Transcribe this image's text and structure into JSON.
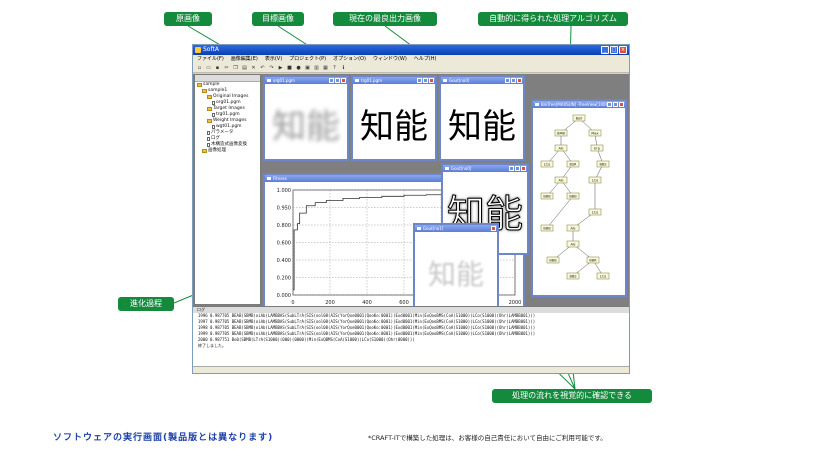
{
  "callouts": {
    "original": "原画像",
    "target": "目標画像",
    "best": "現在の最良出力画像",
    "algorithm": "自動的に得られた処理アルゴリズム",
    "evolution": "進化過程",
    "flow": "処理の流れを視覚的に確認できる"
  },
  "window": {
    "title": "SoftA",
    "menu": [
      "ファイル(F)",
      "画像編集(E)",
      "表示(V)",
      "プロジェクト(P)",
      "オプション(O)",
      "ウィンドウ(W)",
      "ヘルプ(H)"
    ],
    "controls": {
      "minimize": "_",
      "maximize": "□",
      "close": "×"
    }
  },
  "toolbar_icons": [
    "new-icon",
    "open-icon",
    "save-icon",
    "cut-icon",
    "copy-icon",
    "paste-icon",
    "delete-icon",
    "undo-icon",
    "redo-icon",
    "run-icon",
    "stop-icon",
    "record-icon",
    "image-icon",
    "chart-icon",
    "tree-icon",
    "help-icon",
    "info-icon"
  ],
  "tree": {
    "nodes": [
      {
        "label": "sample",
        "kind": "folder",
        "depth": 0
      },
      {
        "label": "sample1",
        "kind": "folder",
        "depth": 1
      },
      {
        "label": "Original Images",
        "kind": "folder",
        "depth": 2
      },
      {
        "label": "org01.pgm",
        "kind": "file",
        "depth": 3
      },
      {
        "label": "Target Images",
        "kind": "folder",
        "depth": 2
      },
      {
        "label": "trg01.pgm",
        "kind": "file",
        "depth": 3
      },
      {
        "label": "Weight Images",
        "kind": "folder",
        "depth": 2
      },
      {
        "label": "wgt01.pgm",
        "kind": "file",
        "depth": 3
      },
      {
        "label": "パラメータ",
        "kind": "file",
        "depth": 2
      },
      {
        "label": "ログ",
        "kind": "file",
        "depth": 2
      },
      {
        "label": "木構造式画像変換",
        "kind": "file",
        "depth": 2
      },
      {
        "label": "画像処理",
        "kind": "folder",
        "depth": 1
      }
    ]
  },
  "panes": {
    "original": {
      "title": "org01.pgm",
      "text": "知能"
    },
    "target": {
      "title": "trg01.pgm",
      "text": "知能"
    },
    "best": {
      "title": "Gout[no0]",
      "text": "知能"
    },
    "output2": {
      "title": "Gout[no0]",
      "text": "知能"
    },
    "small": {
      "title": "Gout[no1]",
      "text": "知能"
    },
    "tree_view": {
      "title": "BinTree[MAXSUN] -TreeView[1000]"
    },
    "fitness": {
      "title": "Fitness"
    }
  },
  "algorithm_nodes": [
    "Bo0",
    "BMB",
    "Max",
    "AG",
    "Erp",
    "LCo",
    "BSR",
    "BBS",
    "AG",
    "LCo",
    "BBB",
    "BBB",
    "LCo",
    "AG",
    "BBB",
    "AG",
    "BBB",
    "BBR",
    "BBS",
    "LCo"
  ],
  "chart_data": {
    "type": "line",
    "title": "",
    "xlabel": "",
    "ylabel": "",
    "xlim": [
      0,
      2000
    ],
    "ylim": [
      0.0,
      1.0
    ],
    "x_ticks": [
      "0",
      "200",
      "400",
      "600",
      "800",
      "1000",
      "2000"
    ],
    "y_ticks": [
      "0.000",
      "0.200",
      "0.400",
      "0.600",
      "0.800",
      "0.950",
      "1.000"
    ],
    "grid": true,
    "series": [
      {
        "x": [
          0,
          8,
          10,
          40,
          60,
          120,
          200,
          300,
          450,
          600,
          800,
          1000,
          1200,
          1400,
          1600,
          1800,
          2000
        ],
        "y": [
          0.05,
          0.05,
          0.62,
          0.68,
          0.78,
          0.85,
          0.88,
          0.9,
          0.92,
          0.93,
          0.94,
          0.95,
          0.955,
          0.96,
          0.96,
          0.965,
          0.965
        ]
      }
    ]
  },
  "log": {
    "title": "ログ",
    "rows": [
      "1996  0.987705  BEAB(SBMB(oiAb(LAMBBAS(SubLTrA(SIS(ool08(AIS(YorQxe0001(QooKo:0001)(Exd0001(Min(ExQooBMS(CoA(S1000)(LCo(S1000)(Ohr(LAMBB001)))",
      "1997  0.987705  BEAB(SBMB(oiAb(LAMBBAS(SubLTrA(SIS(ool08(AIS(YorQxe0001(QooKo:0001)(Exd0001(Min(ExQooBMS(CoA(S1000)(LCo(S1000)(Ohr(LAMBB001)))",
      "1998  0.987705  BEAB(SBMB(oiAb(LAMBBAS(SubLTrA(SIS(ool08(AIS(YorQxe0001(QooKo:0001)(Exd0001(Min(ExQooBMS(CoA(S1000)(LCo(S1000)(Ohr(LAMBB001)))",
      "1999  0.987705  BEAB(SBMB(oiAb(LAMBBAS(SubLTrA(SIS(ool08(AIS(YorQxe0001(QooKo:0001)(Exd0001(Min(ExQooBMS(CoA(S1000)(LCo(S1000)(Ohr(LAMBB001)))",
      "2000  0.987751  Bo0(SBMB(LTrA(S1000)(000)(0000)(Min(ExQBMS(CoA(S1000)(LCo(S1000)(Ohr(0000)))",
      "終了しました。"
    ]
  },
  "caption": "ソフトウェアの実行画面(製品版とは異なります)",
  "note": "*CRAFT-ITで構築した処理は、お客様の自己責任において自由にご利用可能です。",
  "colors": {
    "callout": "#138a3c",
    "caption": "#1a3fa8",
    "titlebar": "#0a3fb4"
  }
}
